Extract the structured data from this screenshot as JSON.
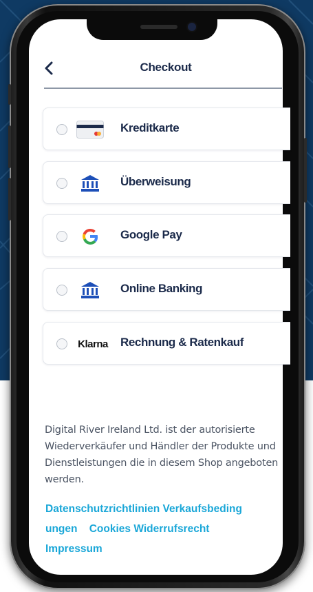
{
  "header": {
    "title": "Checkout",
    "back_icon": "chevron-left-icon"
  },
  "payment_options": [
    {
      "label": "Kreditkarte",
      "icon": "credit-card-icon",
      "selected": false
    },
    {
      "label": "Überweisung",
      "icon": "bank-icon",
      "selected": false
    },
    {
      "label": "Google Pay",
      "icon": "google-icon",
      "selected": false
    },
    {
      "label": "Online Banking",
      "icon": "bank-icon",
      "selected": false
    },
    {
      "label": "Rechnung & Ratenkauf",
      "icon": "klarna-logo",
      "icon_text": "Klarna",
      "selected": false
    }
  ],
  "legal": {
    "text": "Digital River Ireland Ltd. ist der autorisierte Wiederverkäufer und Händler der Produkte und Dienstleistungen die in diesem Shop angeboten werden."
  },
  "links": {
    "privacy": "Datenschutzrichtlinien",
    "terms_part1": "Verkaufsbeding",
    "terms_part2": "ungen",
    "cookies": "Cookies",
    "withdrawal": "Widerrufsrecht",
    "imprint": "Impressum"
  },
  "colors": {
    "background_navy": "#0f3a63",
    "text_dark": "#1b2a4a",
    "link": "#1aa7d8",
    "bank_blue": "#1d4fb8"
  }
}
